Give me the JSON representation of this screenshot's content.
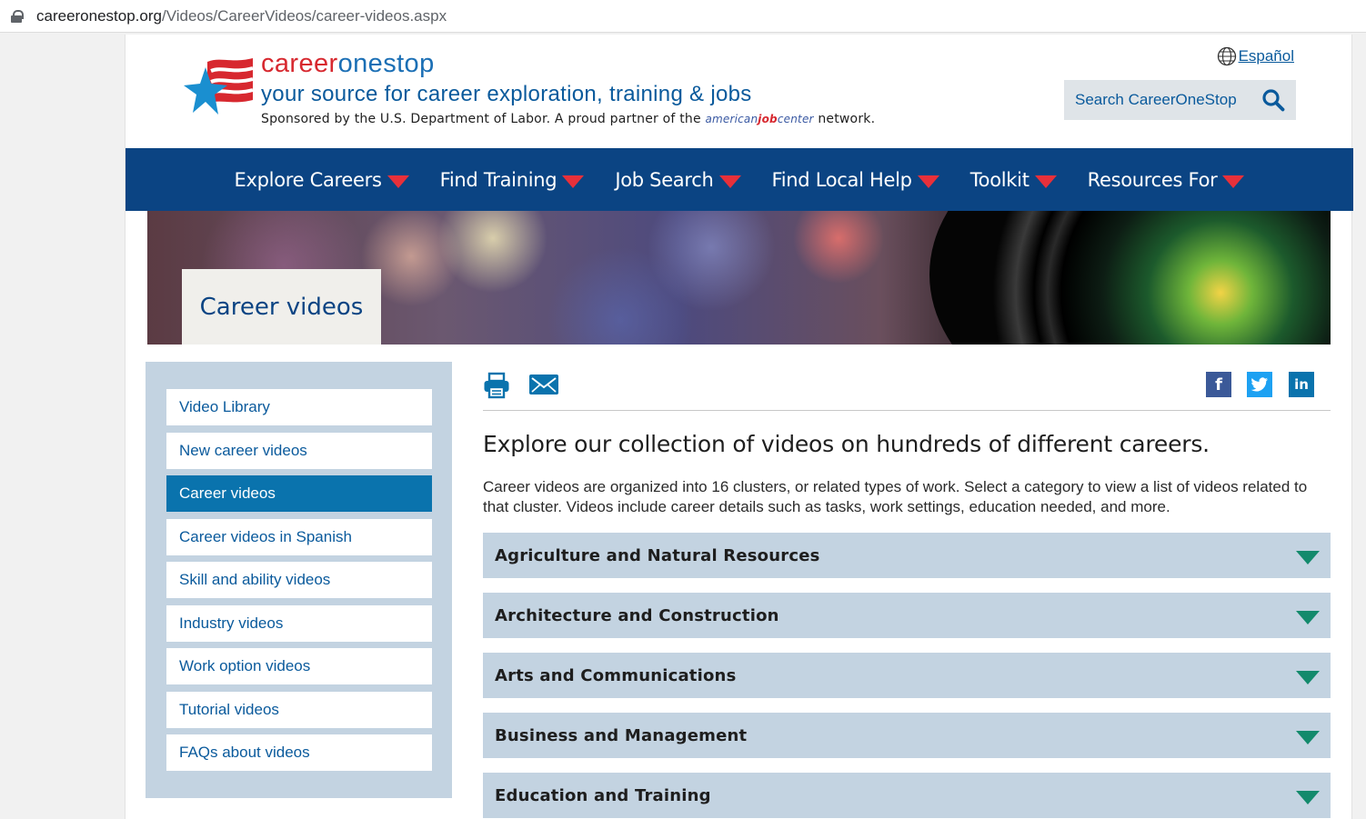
{
  "browser": {
    "url_host": "careeronestop.org",
    "url_path": "/Videos/CareerVideos/career-videos.aspx"
  },
  "header": {
    "brand_part1": "career",
    "brand_part2": "onestop",
    "tagline": "your source for career exploration, training & jobs",
    "sponsor_prefix": "Sponsored by the U.S. Department of Labor. A proud partner of the",
    "ajc_1": "american",
    "ajc_2": "job",
    "ajc_3": "center",
    "sponsor_suffix": "network.",
    "language_link": "Español",
    "search_label": "Search CareerOneStop"
  },
  "nav": {
    "items": [
      "Explore Careers",
      "Find Training",
      "Job Search",
      "Find Local Help",
      "Toolkit",
      "Resources For"
    ]
  },
  "banner": {
    "title": "Career videos"
  },
  "sidebar": {
    "items": [
      {
        "label": "Video Library",
        "active": false
      },
      {
        "label": "New career videos",
        "active": false
      },
      {
        "label": "Career videos",
        "active": true
      },
      {
        "label": "Career videos in Spanish",
        "active": false
      },
      {
        "label": "Skill and ability videos",
        "active": false
      },
      {
        "label": "Industry videos",
        "active": false
      },
      {
        "label": "Work option videos",
        "active": false
      },
      {
        "label": "Tutorial videos",
        "active": false
      },
      {
        "label": "FAQs about videos",
        "active": false
      }
    ]
  },
  "social": {
    "facebook": "f",
    "twitter": "t",
    "linkedin": "in"
  },
  "main": {
    "headline": "Explore our collection of videos on hundreds of different careers.",
    "intro": "Career videos are organized into 16 clusters, or related types of work. Select a category to view a list of videos related to that cluster. Videos include career details such as tasks, work settings, education needed, and more.",
    "clusters": [
      "Agriculture and Natural Resources",
      "Architecture and Construction",
      "Arts and Communications",
      "Business and Management",
      "Education and Training"
    ]
  },
  "colors": {
    "nav_bg": "#0b4483",
    "nav_arrow": "#e8303a",
    "accordion_bg": "#c3d3e1",
    "accordion_arrow": "#138a6c",
    "active_sidebar": "#0a73ad"
  }
}
